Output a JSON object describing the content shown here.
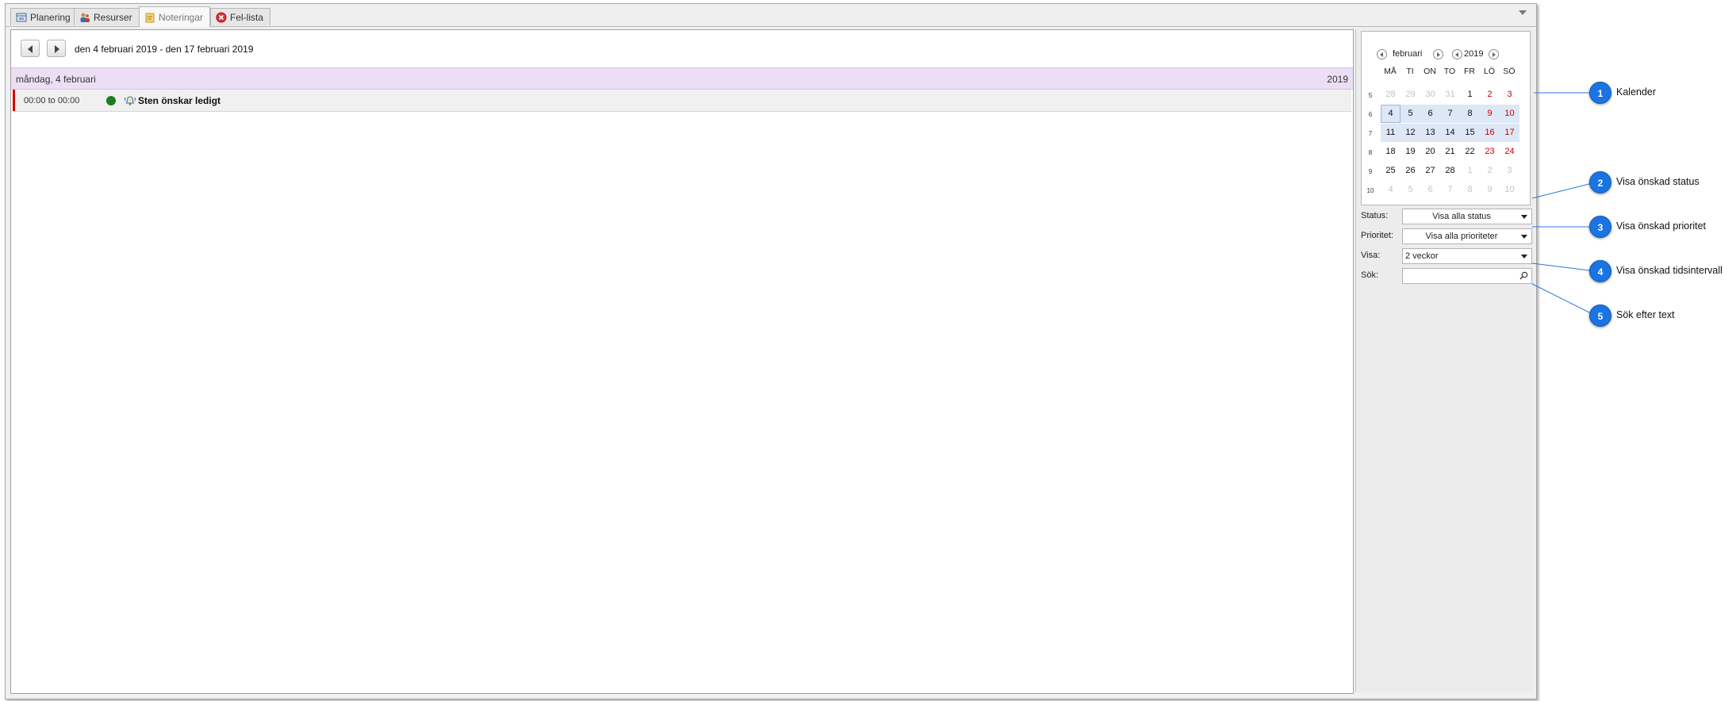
{
  "tabs": [
    {
      "label": "Planering",
      "icon": "planning-icon"
    },
    {
      "label": "Resurser",
      "icon": "resources-icon"
    },
    {
      "label": "Noteringar",
      "icon": "notes-icon",
      "active": true
    },
    {
      "label": "Fel-lista",
      "icon": "error-icon"
    }
  ],
  "toolbar": {
    "date_range": "den 4 februari 2019 - den 17 februari 2019"
  },
  "day": {
    "label": "måndag, 4 februari",
    "year": "2019"
  },
  "event": {
    "time": "00:00 to 00:00",
    "title": "Sten önskar ledigt",
    "status_color": "#1e7c1e",
    "priority_color": "#d40000"
  },
  "calendar": {
    "month": "februari",
    "year": "2019",
    "weekdays": [
      "MÅ",
      "TI",
      "ON",
      "TO",
      "FR",
      "LÖ",
      "SÖ"
    ],
    "weeks": [
      {
        "num": "5",
        "days": [
          "28",
          "29",
          "30",
          "31",
          "1",
          "2",
          "3"
        ]
      },
      {
        "num": "6",
        "days": [
          "4",
          "5",
          "6",
          "7",
          "8",
          "9",
          "10"
        ]
      },
      {
        "num": "7",
        "days": [
          "11",
          "12",
          "13",
          "14",
          "15",
          "16",
          "17"
        ]
      },
      {
        "num": "8",
        "days": [
          "18",
          "19",
          "20",
          "21",
          "22",
          "23",
          "24"
        ]
      },
      {
        "num": "9",
        "days": [
          "25",
          "26",
          "27",
          "28",
          "1",
          "2",
          "3"
        ]
      },
      {
        "num": "10",
        "days": [
          "4",
          "5",
          "6",
          "7",
          "8",
          "9",
          "10"
        ]
      }
    ]
  },
  "filters": {
    "status_label": "Status:",
    "status_value": "Visa alla status",
    "priority_label": "Prioritet:",
    "priority_value": "Visa alla prioriteter",
    "show_label": "Visa:",
    "show_value": "2 veckor",
    "search_label": "Sök:",
    "search_value": ""
  },
  "callouts": [
    {
      "num": "1",
      "text": "Kalender"
    },
    {
      "num": "2",
      "text": "Visa önskad status"
    },
    {
      "num": "3",
      "text": "Visa önskad prioritet"
    },
    {
      "num": "4",
      "text": "Visa önskad tidsintervall"
    },
    {
      "num": "5",
      "text": "Sök efter text"
    }
  ],
  "colors": {
    "callout_blue": "#1a74e2",
    "weekend_red": "#cc0000",
    "day_header_bg": "#ecdff5"
  }
}
